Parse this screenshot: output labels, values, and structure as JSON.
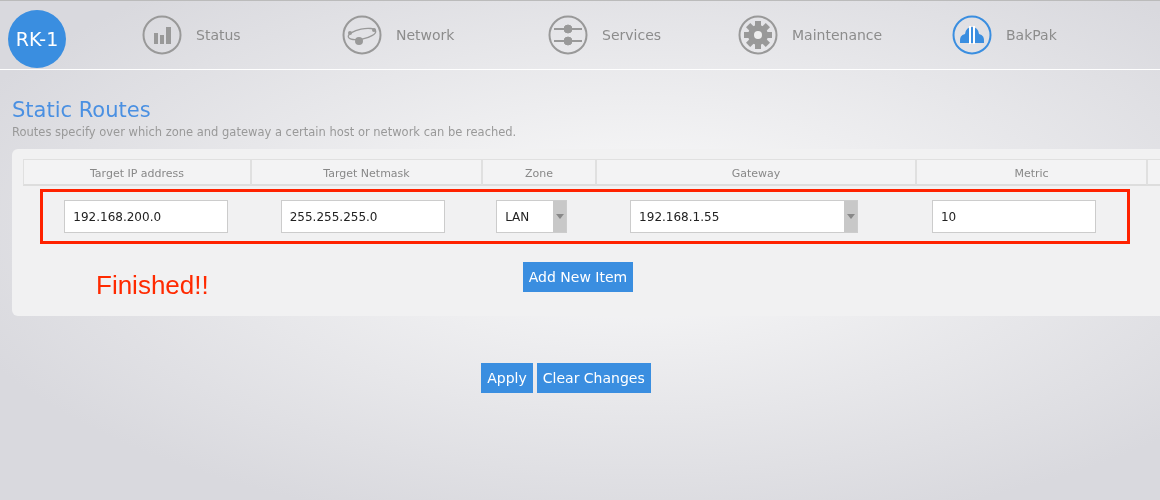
{
  "logo": "RK-1",
  "nav": [
    {
      "label": "Status",
      "selected": false
    },
    {
      "label": "Network",
      "selected": false
    },
    {
      "label": "Services",
      "selected": false
    },
    {
      "label": "Maintenance",
      "selected": false
    },
    {
      "label": "BakPak",
      "selected": true
    }
  ],
  "page": {
    "title": "Static Routes",
    "description": "Routes specify over which zone and gateway a certain host or network can be reached."
  },
  "table": {
    "columns": [
      "Target IP address",
      "Target Netmask",
      "Zone",
      "Gateway",
      "Metric"
    ],
    "rows": [
      [
        {
          "kind": "text",
          "value": "192.168.200.0"
        },
        {
          "kind": "text",
          "value": "255.255.255.0"
        },
        {
          "kind": "select",
          "value": "LAN"
        },
        {
          "kind": "select",
          "value": "192.168.1.55"
        },
        {
          "kind": "text",
          "value": "10"
        }
      ]
    ],
    "highlighted": true
  },
  "annotation": "Finished!!",
  "add_button": "Add New Item",
  "buttons": [
    "Apply",
    "Clear Changes"
  ]
}
